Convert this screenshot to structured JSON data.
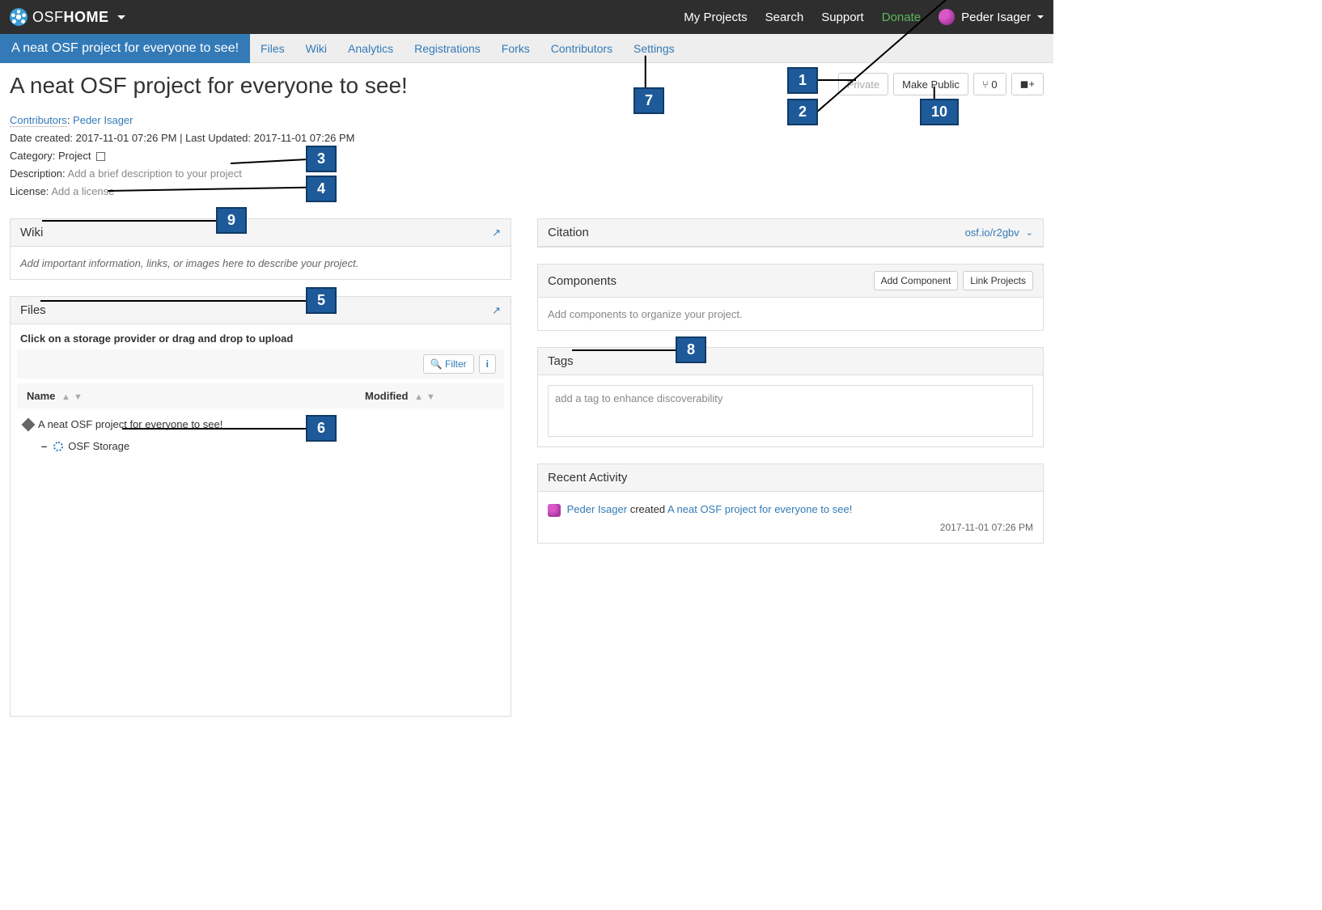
{
  "brand": {
    "prefix": "OSF",
    "suffix": "HOME"
  },
  "topnav": {
    "my_projects": "My Projects",
    "search": "Search",
    "support": "Support",
    "donate": "Donate",
    "username": "Peder Isager"
  },
  "subnav": {
    "project_title": "A neat OSF project for everyone to see!",
    "tabs": [
      "Files",
      "Wiki",
      "Analytics",
      "Registrations",
      "Forks",
      "Contributors",
      "Settings"
    ]
  },
  "actions": {
    "private": "Private",
    "make_public": "Make Public",
    "forks_count": "0",
    "fork_symbol": "⑂",
    "bookmark_symbol": "🔖+"
  },
  "project": {
    "title": "A neat OSF project for everyone to see!",
    "contributors_label": "Contributors",
    "contributor_name": "Peder Isager",
    "date_created_label": "Date created:",
    "date_created": "2017-11-01 07:26 PM",
    "last_updated_label": "Last Updated:",
    "last_updated": "2017-11-01 07:26 PM",
    "category_label": "Category:",
    "category_value": "Project",
    "description_label": "Description:",
    "description_placeholder": "Add a brief description to your project",
    "license_label": "License:",
    "license_placeholder": "Add a license"
  },
  "wiki": {
    "title": "Wiki",
    "placeholder": "Add important information, links, or images here to describe your project."
  },
  "files": {
    "title": "Files",
    "instruction": "Click on a storage provider or drag and drop to upload",
    "filter_label": "Filter",
    "name_header": "Name",
    "modified_header": "Modified",
    "root_name": "A neat OSF project for everyone to see!",
    "storage_name": "OSF Storage"
  },
  "citation": {
    "title": "Citation",
    "url": "osf.io/r2gbv"
  },
  "components": {
    "title": "Components",
    "add_btn": "Add Component",
    "link_btn": "Link Projects",
    "placeholder": "Add components to organize your project."
  },
  "tags": {
    "title": "Tags",
    "placeholder": "add a tag to enhance discoverability"
  },
  "activity": {
    "title": "Recent Activity",
    "user": "Peder Isager",
    "verb": "created",
    "target": "A neat OSF project for everyone to see!",
    "timestamp": "2017-11-01 07:26 PM"
  },
  "callouts": {
    "c1": "1",
    "c2": "2",
    "c3": "3",
    "c4": "4",
    "c5": "5",
    "c6": "6",
    "c7": "7",
    "c8": "8",
    "c9": "9",
    "c10": "10"
  }
}
